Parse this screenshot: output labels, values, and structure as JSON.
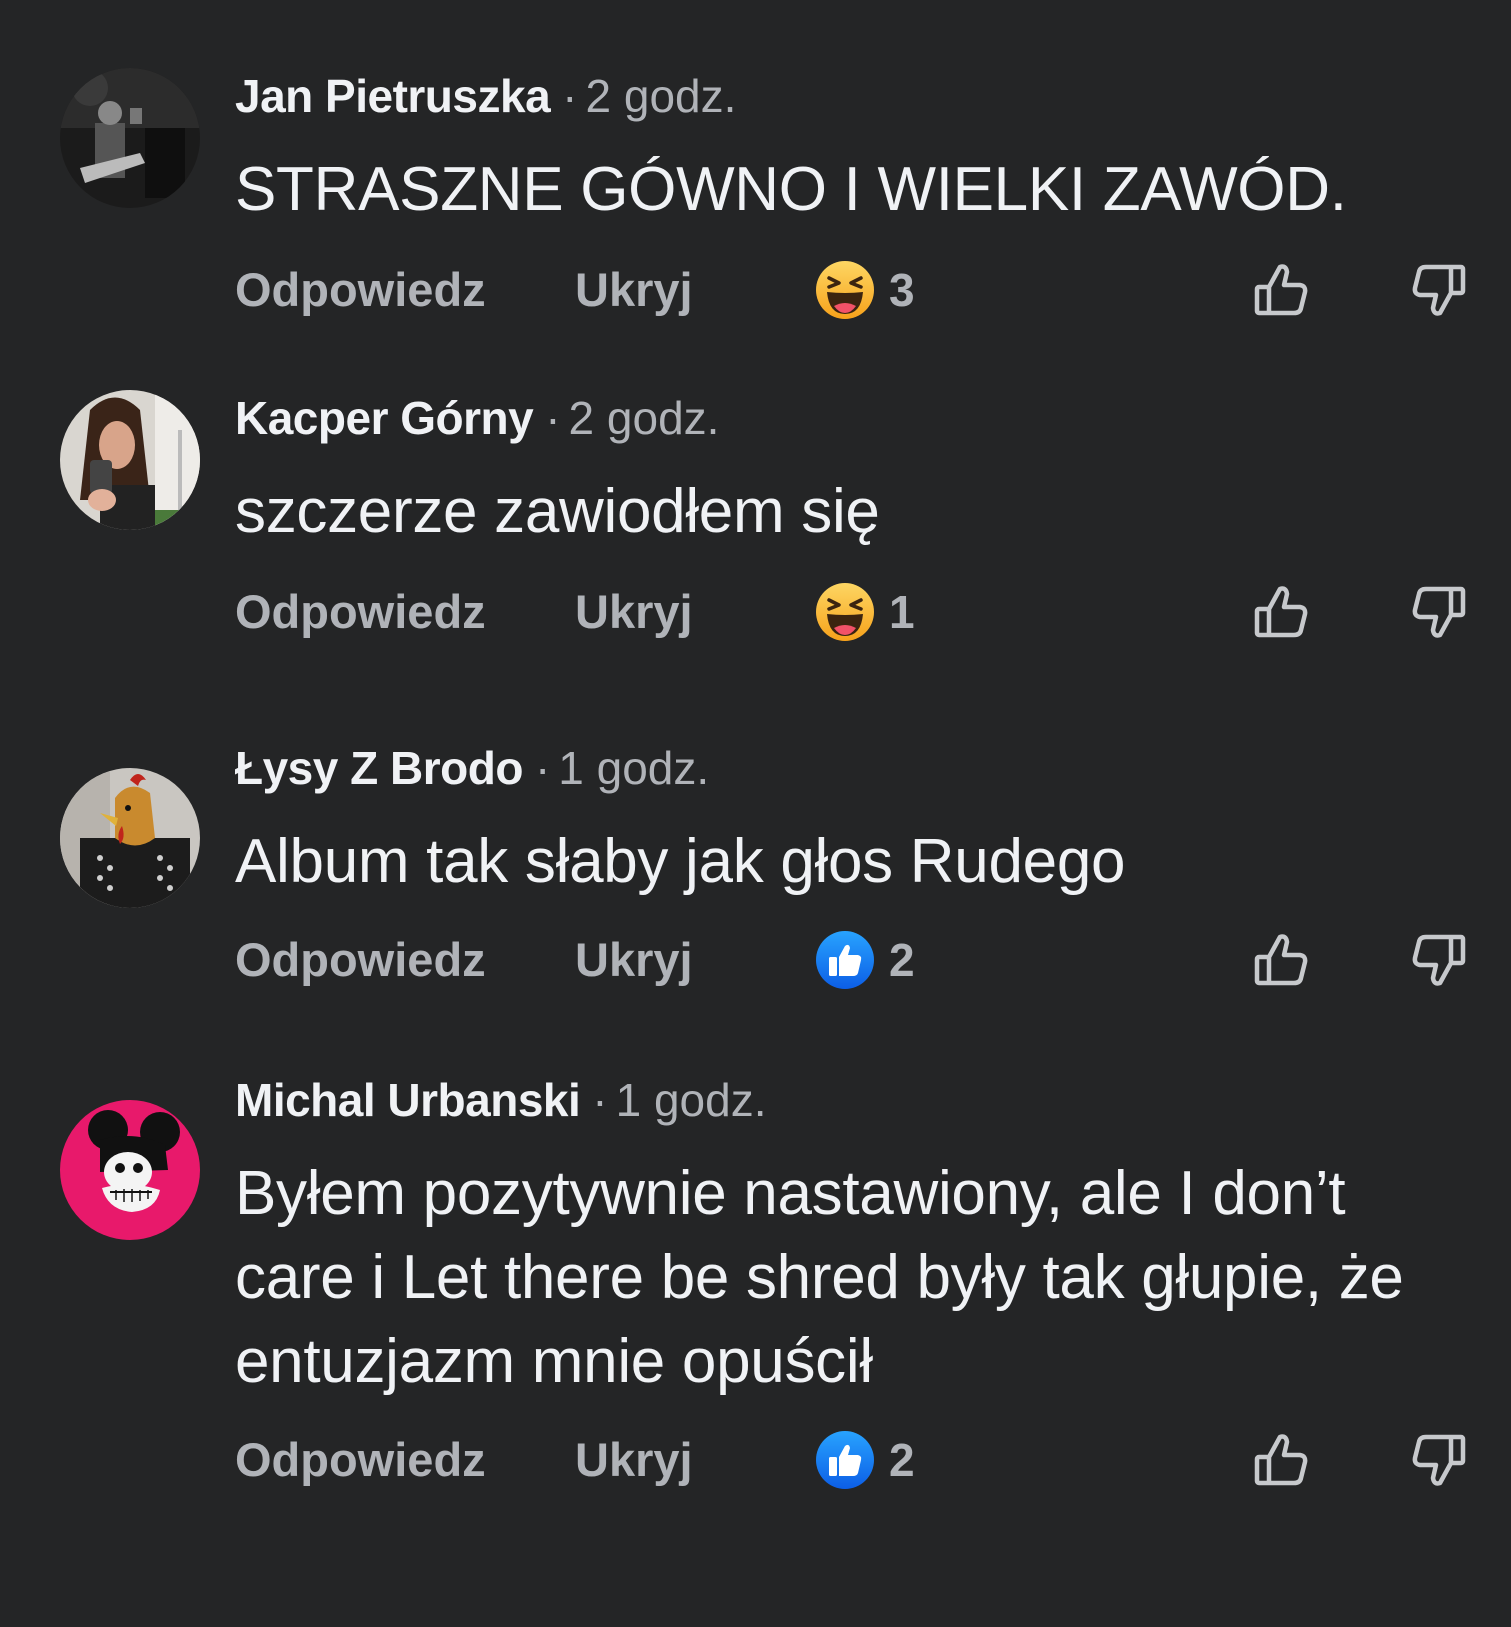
{
  "comments": [
    {
      "author": "Jan Pietruszka",
      "separator": "·",
      "time": "2 godz.",
      "text": "STRASZNE GÓWNO I WIELKI ZAWÓD.",
      "reply_label": "Odpowiedz",
      "hide_label": "Ukryj",
      "reaction_icon": "haha-emoji-icon",
      "reaction_count": "3"
    },
    {
      "author": "Kacper Górny",
      "separator": "·",
      "time": "2 godz.",
      "text": "szczerze zawiodłem się",
      "reply_label": "Odpowiedz",
      "hide_label": "Ukryj",
      "reaction_icon": "haha-emoji-icon",
      "reaction_count": "1"
    },
    {
      "author": "Łysy Z Brodo",
      "separator": "·",
      "time": "1 godz.",
      "text": "Album tak słaby jak głos Rudego",
      "reply_label": "Odpowiedz",
      "hide_label": "Ukryj",
      "reaction_icon": "like-reaction-icon",
      "reaction_count": "2"
    },
    {
      "author": "Michal Urbanski",
      "separator": "·",
      "time": "1 godz.",
      "text": "Byłem pozytywnie nastawiony, ale I don’t care i Let there be shred były tak głupie, że entuzjazm mnie opuścił",
      "reply_label": "Odpowiedz",
      "hide_label": "Ukryj",
      "reaction_icon": "like-reaction-icon",
      "reaction_count": "2"
    }
  ],
  "colors": {
    "background": "#242526",
    "primary_text": "#f0f2f5",
    "secondary_text": "#b0b3b8",
    "like_blue": "#1877f2",
    "haha_yellow": "#f7b125",
    "avatar_pink": "#e8196b"
  }
}
